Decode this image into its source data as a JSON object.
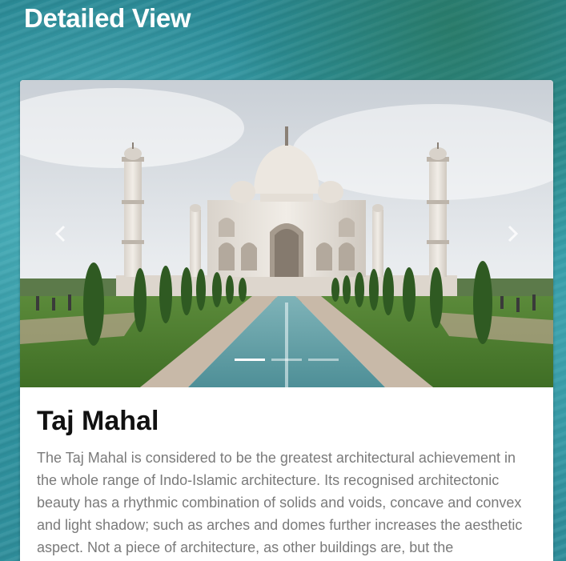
{
  "page": {
    "title": "Detailed View"
  },
  "card": {
    "title": "Taj Mahal",
    "description": "The Taj Mahal is considered to be the greatest architectural achievement in the whole range of Indo-Islamic architecture. Its recognised architectonic beauty has a rhythmic combination of solids and voids, concave and convex and light shadow; such as arches and domes further increases the aesthetic aspect. Not a piece of architecture, as other buildings are, but the",
    "image_subject": "Taj Mahal"
  },
  "carousel": {
    "prev_icon": "chevron-left-icon",
    "next_icon": "chevron-right-icon",
    "slide_count": 3,
    "active_slide": 1
  },
  "colors": {
    "title_text": "#ffffff",
    "heading_text": "#111111",
    "body_text": "#7a7a7a",
    "background": "#2f98a4"
  }
}
